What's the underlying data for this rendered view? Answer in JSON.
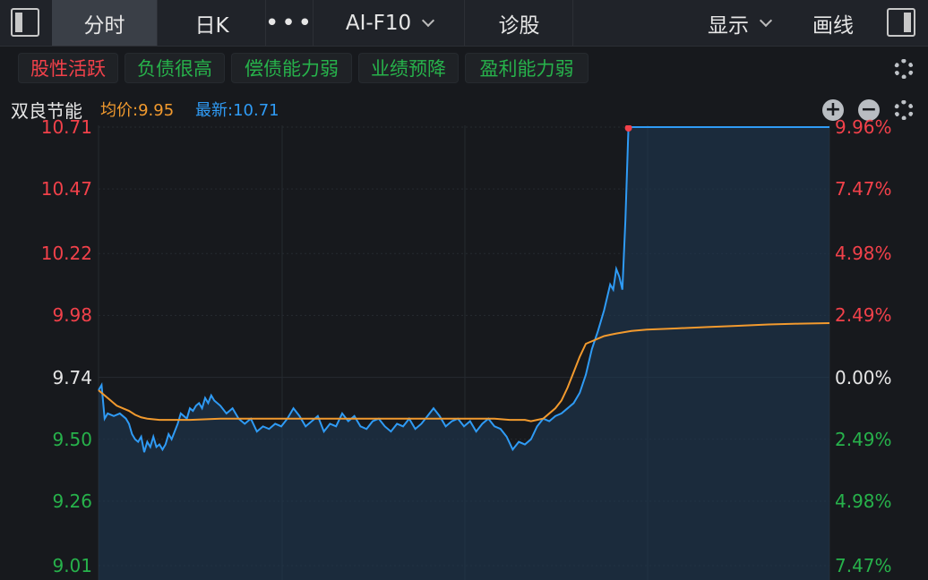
{
  "topbar": {
    "tabs": [
      {
        "label": "分时",
        "active": true
      },
      {
        "label": "日K",
        "active": false
      },
      {
        "label": "•••",
        "active": false
      },
      {
        "label": "AI-F10",
        "active": false
      },
      {
        "label": "诊股",
        "active": false
      }
    ],
    "display_label": "显示",
    "draw_label": "画线"
  },
  "tags": [
    {
      "label": "股性活跃",
      "color": "#f2414a"
    },
    {
      "label": "负债很高",
      "color": "#27b24b"
    },
    {
      "label": "偿债能力弱",
      "color": "#27b24b"
    },
    {
      "label": "业绩预降",
      "color": "#27b24b"
    },
    {
      "label": "盈利能力弱",
      "color": "#27b24b"
    }
  ],
  "info": {
    "name": "双良节能",
    "avg_text": "均价:9.95",
    "last_text": "最新:10.71"
  },
  "colors": {
    "price_line": "#2f9bf5",
    "avg_line": "#f29a2e",
    "up": "#f2414a",
    "down": "#27b24b",
    "background": "#17191d",
    "grid": "#262a30"
  },
  "chart_data": {
    "type": "line",
    "prev_close": 9.74,
    "ylim": [
      9.01,
      10.71
    ],
    "xlim": [
      0,
      240
    ],
    "left_ticks": [
      {
        "label": "10.71",
        "value": 10.71,
        "tone": "up"
      },
      {
        "label": "10.47",
        "value": 10.47,
        "tone": "up"
      },
      {
        "label": "10.22",
        "value": 10.22,
        "tone": "up"
      },
      {
        "label": "9.98",
        "value": 9.98,
        "tone": "up"
      },
      {
        "label": "9.74",
        "value": 9.74,
        "tone": "flat"
      },
      {
        "label": "9.50",
        "value": 9.5,
        "tone": "down"
      },
      {
        "label": "9.26",
        "value": 9.26,
        "tone": "down"
      },
      {
        "label": "9.01",
        "value": 9.01,
        "tone": "down"
      }
    ],
    "right_ticks": [
      {
        "label": "9.96%",
        "value": 10.71,
        "tone": "up"
      },
      {
        "label": "7.47%",
        "value": 10.47,
        "tone": "up"
      },
      {
        "label": "4.98%",
        "value": 10.22,
        "tone": "up"
      },
      {
        "label": "2.49%",
        "value": 9.98,
        "tone": "up"
      },
      {
        "label": "0.00%",
        "value": 9.74,
        "tone": "flat"
      },
      {
        "label": "2.49%",
        "value": 9.5,
        "tone": "down"
      },
      {
        "label": "4.98%",
        "value": 9.26,
        "tone": "down"
      },
      {
        "label": "7.47%",
        "value": 9.01,
        "tone": "down"
      }
    ],
    "series": [
      {
        "role": "price",
        "x": [
          0,
          1,
          2,
          3,
          5,
          7,
          9,
          10,
          11,
          12,
          13,
          14,
          15,
          16,
          17,
          18,
          19,
          20,
          21,
          22,
          23,
          24,
          25,
          26,
          27,
          28,
          29,
          30,
          31,
          32,
          33,
          34,
          35,
          36,
          37,
          38,
          40,
          42,
          44,
          46,
          48,
          50,
          52,
          54,
          56,
          58,
          60,
          62,
          64,
          66,
          68,
          70,
          72,
          74,
          76,
          78,
          80,
          82,
          84,
          86,
          88,
          90,
          92,
          94,
          96,
          98,
          100,
          102,
          104,
          106,
          108,
          110,
          112,
          114,
          116,
          118,
          120,
          122,
          124,
          126,
          128,
          130,
          132,
          134,
          136,
          138,
          140,
          142,
          144,
          146,
          148,
          150,
          152,
          154,
          156,
          158,
          160,
          162,
          164,
          166,
          167,
          168,
          169,
          170,
          171,
          172,
          173,
          174,
          175,
          176,
          177,
          178,
          179,
          180,
          181,
          182,
          183,
          184,
          185,
          186,
          240
        ],
        "y": [
          9.69,
          9.71,
          9.58,
          9.6,
          9.59,
          9.6,
          9.58,
          9.56,
          9.52,
          9.5,
          9.49,
          9.51,
          9.45,
          9.49,
          9.47,
          9.51,
          9.47,
          9.48,
          9.46,
          9.48,
          9.52,
          9.5,
          9.53,
          9.56,
          9.6,
          9.59,
          9.58,
          9.62,
          9.61,
          9.63,
          9.64,
          9.62,
          9.66,
          9.64,
          9.67,
          9.65,
          9.63,
          9.6,
          9.62,
          9.58,
          9.56,
          9.58,
          9.53,
          9.55,
          9.54,
          9.56,
          9.55,
          9.58,
          9.62,
          9.59,
          9.55,
          9.57,
          9.59,
          9.53,
          9.56,
          9.55,
          9.6,
          9.57,
          9.59,
          9.55,
          9.54,
          9.57,
          9.58,
          9.55,
          9.53,
          9.56,
          9.55,
          9.58,
          9.54,
          9.56,
          9.59,
          9.62,
          9.59,
          9.55,
          9.57,
          9.58,
          9.55,
          9.57,
          9.53,
          9.56,
          9.58,
          9.55,
          9.54,
          9.51,
          9.46,
          9.49,
          9.48,
          9.5,
          9.55,
          9.58,
          9.57,
          9.59,
          9.6,
          9.62,
          9.64,
          9.68,
          9.75,
          9.85,
          9.92,
          10.0,
          10.05,
          10.1,
          10.08,
          10.16,
          10.13,
          10.08,
          10.35,
          10.71,
          10.71,
          10.71,
          10.71,
          10.71,
          10.71,
          10.71,
          10.71,
          10.71,
          10.71,
          10.71,
          10.71,
          10.71,
          10.71
        ]
      },
      {
        "role": "average",
        "x": [
          0,
          2,
          4,
          6,
          8,
          10,
          12,
          14,
          16,
          20,
          30,
          40,
          60,
          80,
          100,
          120,
          130,
          135,
          140,
          142,
          144,
          146,
          148,
          150,
          152,
          154,
          156,
          158,
          160,
          162,
          164,
          166,
          168,
          170,
          175,
          180,
          190,
          200,
          210,
          220,
          230,
          240
        ],
        "y": [
          9.69,
          9.67,
          9.65,
          9.63,
          9.62,
          9.61,
          9.595,
          9.585,
          9.58,
          9.575,
          9.575,
          9.58,
          9.58,
          9.58,
          9.58,
          9.58,
          9.58,
          9.575,
          9.575,
          9.57,
          9.575,
          9.58,
          9.6,
          9.62,
          9.65,
          9.7,
          9.76,
          9.82,
          9.87,
          9.88,
          9.89,
          9.9,
          9.905,
          9.91,
          9.92,
          9.925,
          9.93,
          9.935,
          9.94,
          9.945,
          9.948,
          9.95
        ]
      }
    ]
  }
}
